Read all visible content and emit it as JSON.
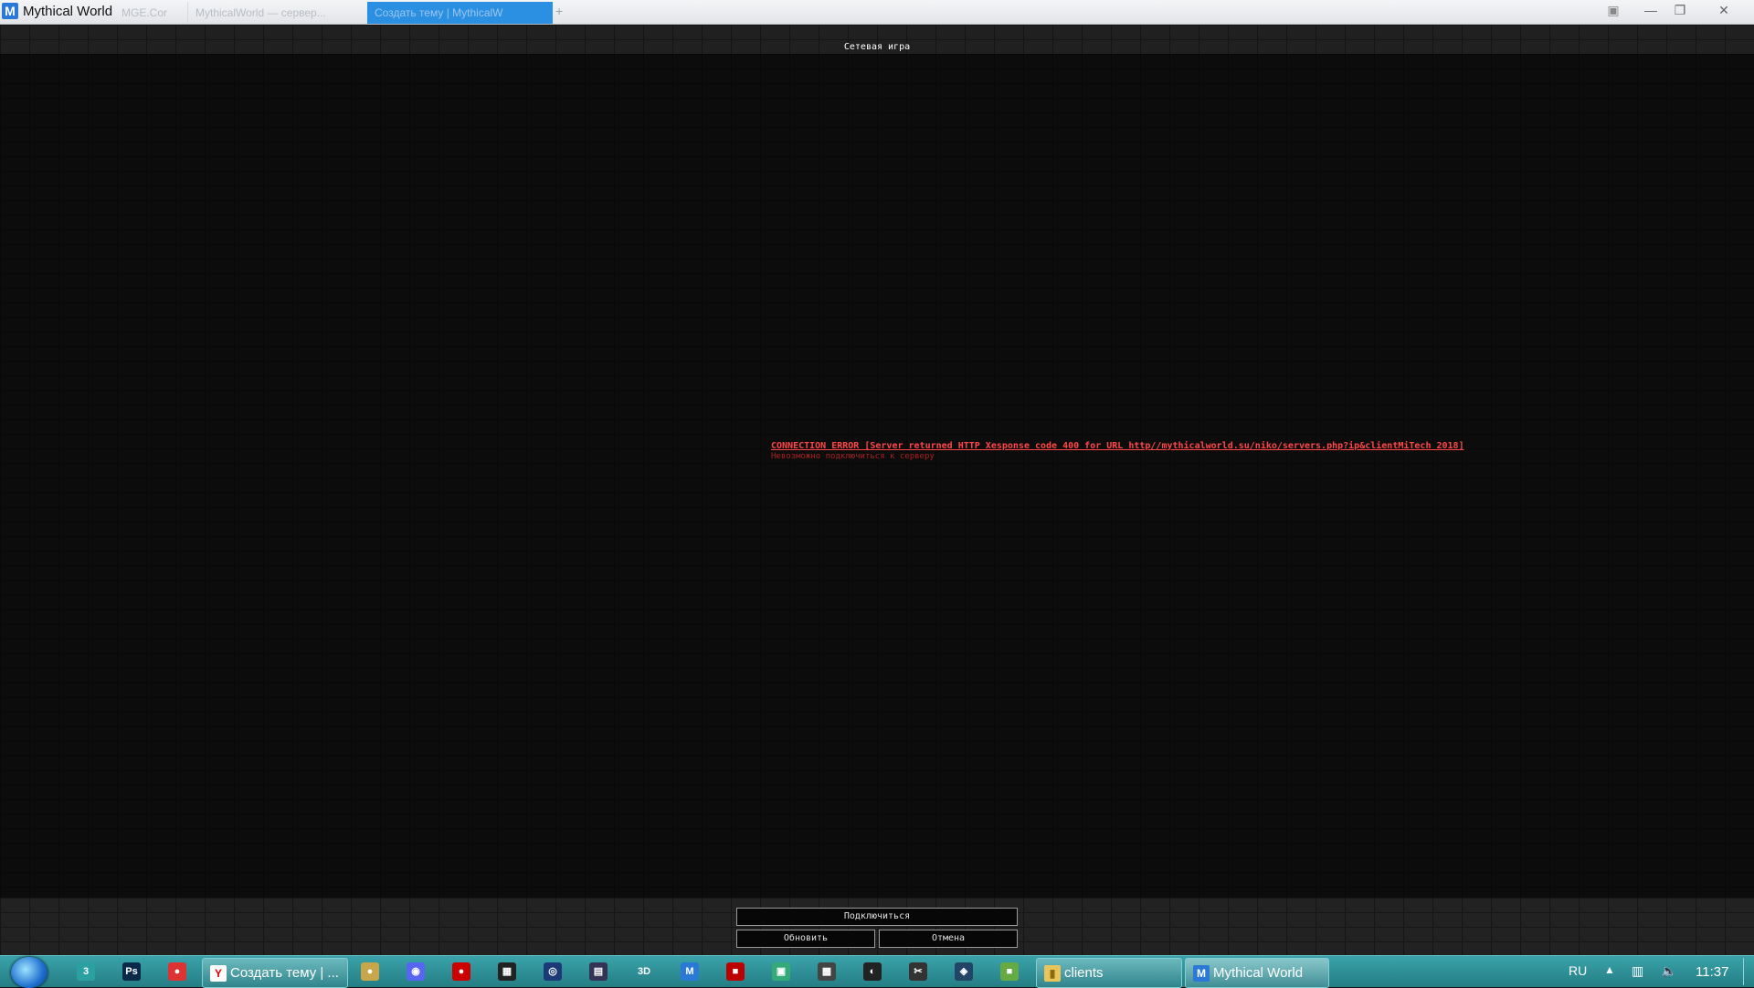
{
  "window": {
    "title": "Mythical World",
    "app_icon_letter": "M",
    "tabs": [
      {
        "label": "MGE.Cor"
      },
      {
        "label": "MythicalWorld — сервер..."
      },
      {
        "label": "Создать тему | MythicalW"
      }
    ],
    "add_tab": "+",
    "controls": {
      "menu": "▣",
      "minimize": "—",
      "maximize": "❐",
      "close": "✕"
    }
  },
  "game": {
    "screen_title": "Сетевая игра",
    "error_line": "CONNECTION ERROR [Server returned HTTP Xesponse code 400 for URL http//mythicalworld.su/niko/servers.php?ip&clientMiTech 2018]",
    "error_sub": "Невозможно подключиться к серверу",
    "buttons": {
      "connect": "Подключиться",
      "refresh": "Обновить",
      "cancel": "Отмена"
    }
  },
  "taskbar": {
    "pinned_icons": [
      {
        "name": "3-icon",
        "glyph": "3",
        "color": "#2aa0a0"
      },
      {
        "name": "photoshop-icon",
        "glyph": "Ps",
        "color": "#0b2a4a"
      },
      {
        "name": "chrome-icon",
        "glyph": "●",
        "color": "#d33"
      },
      {
        "name": "cookie-icon",
        "glyph": "●",
        "color": "#c8a74a"
      },
      {
        "name": "discord-icon",
        "glyph": "◉",
        "color": "#5865f2"
      },
      {
        "name": "record-icon",
        "glyph": "●",
        "color": "#c00"
      },
      {
        "name": "media-icon",
        "glyph": "▦",
        "color": "#222"
      },
      {
        "name": "cinema4d-icon",
        "glyph": "◎",
        "color": "#1c3a78"
      },
      {
        "name": "remote-icon",
        "glyph": "▤",
        "color": "#335"
      },
      {
        "name": "3d-icon",
        "glyph": "3D",
        "color": "transparent"
      },
      {
        "name": "mythical-icon",
        "glyph": "M",
        "color": "#2a79d6"
      },
      {
        "name": "app-red-icon",
        "glyph": "■",
        "color": "#b00"
      },
      {
        "name": "monitor-icon",
        "glyph": "▣",
        "color": "#3a7"
      },
      {
        "name": "gpu-icon",
        "glyph": "▩",
        "color": "#444"
      },
      {
        "name": "obs-icon",
        "glyph": "◐",
        "color": "#222"
      },
      {
        "name": "cutter-icon",
        "glyph": "✂",
        "color": "#333"
      },
      {
        "name": "shield-icon",
        "glyph": "◈",
        "color": "#246"
      },
      {
        "name": "minecraft-icon",
        "glyph": "■",
        "color": "#6a4"
      }
    ],
    "tasks": {
      "yandex": {
        "label": "Создать тему | ...",
        "icon": "Y"
      },
      "clients": {
        "label": "clients",
        "icon": "▮"
      },
      "mythical": {
        "label": "Mythical World",
        "icon": "M"
      }
    },
    "tray": {
      "lang": "RU",
      "arrow": "▲",
      "clock": "11:37"
    }
  }
}
